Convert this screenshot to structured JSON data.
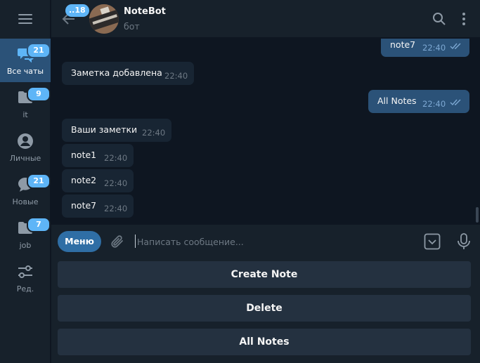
{
  "sidebar": {
    "folders": [
      {
        "label": "Все чаты",
        "badge": "21",
        "icon": "chats-icon"
      },
      {
        "label": "it",
        "badge": "9",
        "icon": "folder-icon"
      },
      {
        "label": "Личные",
        "badge": "",
        "icon": "person-icon"
      },
      {
        "label": "Новые",
        "badge": "21",
        "icon": "chat-bubble-icon"
      },
      {
        "label": "job",
        "badge": "7",
        "icon": "folder-icon"
      },
      {
        "label": "Ред.",
        "badge": "",
        "icon": "edit-folders-icon"
      }
    ]
  },
  "header": {
    "back_badge": "..18",
    "title": "NoteBot",
    "subtitle": "бот"
  },
  "messages": [
    {
      "dir": "out",
      "text": "note7",
      "time": "22:40",
      "read": true
    },
    {
      "dir": "in",
      "text": "Заметка добавлена",
      "time": "22:40"
    },
    {
      "dir": "out",
      "text": "All Notes",
      "time": "22:40",
      "read": true
    },
    {
      "dir": "in",
      "text": "Ваши заметки",
      "time": "22:40"
    },
    {
      "dir": "in",
      "text": "note1",
      "time": "22:40"
    },
    {
      "dir": "in",
      "text": "note2",
      "time": "22:40"
    },
    {
      "dir": "in",
      "text": "note7",
      "time": "22:40"
    }
  ],
  "input": {
    "menu_label": "Меню",
    "placeholder": "Написать сообщение...",
    "value": ""
  },
  "keyboard": {
    "buttons": [
      "Create Note",
      "Delete",
      "All Notes"
    ]
  },
  "colors": {
    "background": "#0e1621",
    "panel": "#17212b",
    "accent": "#5eb5f7",
    "outgoing_bubble": "#2b5278",
    "incoming_bubble": "#182533"
  }
}
